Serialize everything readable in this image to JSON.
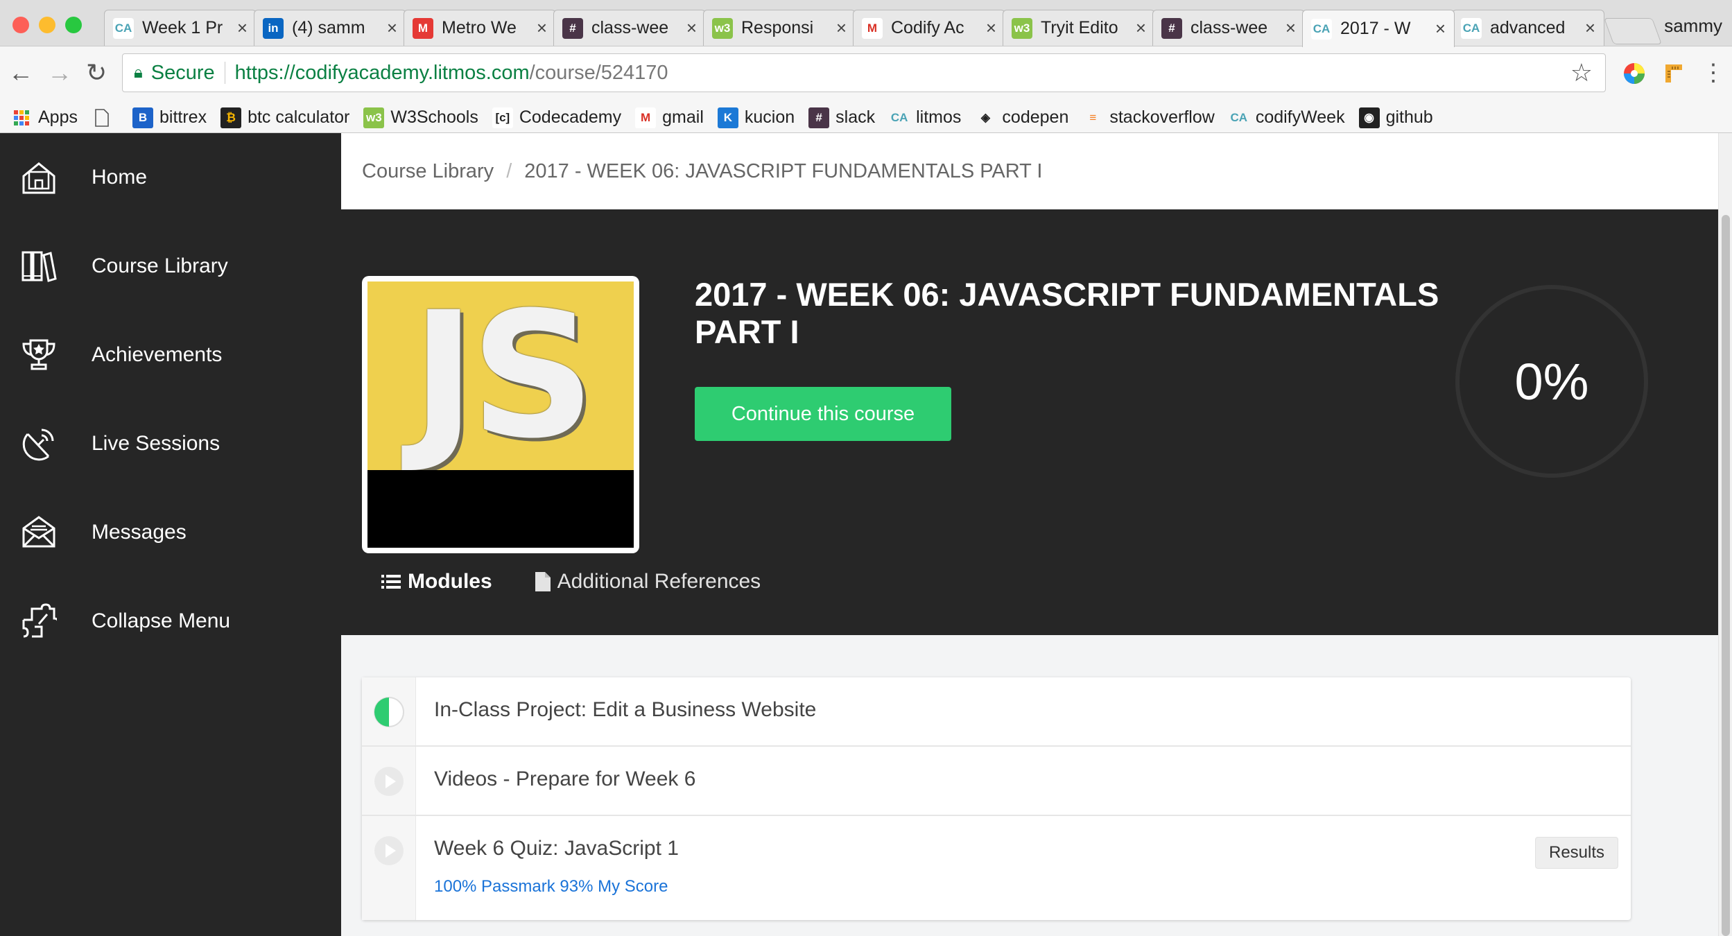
{
  "browser": {
    "tabs": [
      {
        "title": "Week 1 Pr",
        "favicon": "codify-icon",
        "color": "#ffffff",
        "text": "CA",
        "fg": "#4aa3b5"
      },
      {
        "title": "(4) samm",
        "favicon": "linkedin-icon",
        "color": "#0a66c2",
        "text": "in",
        "fg": "#ffffff"
      },
      {
        "title": "Metro We",
        "favicon": "metro-icon",
        "color": "#e53935",
        "text": "M",
        "fg": "#ffffff"
      },
      {
        "title": "class-wee",
        "favicon": "slack-icon",
        "color": "#4a3548",
        "text": "#",
        "fg": "#ffffff"
      },
      {
        "title": "Responsi",
        "favicon": "w3schools-icon",
        "color": "#8bc34a",
        "text": "w3",
        "fg": "#ffffff"
      },
      {
        "title": "Codify Ac",
        "favicon": "gmail-icon",
        "color": "#ffffff",
        "text": "M",
        "fg": "#d93025"
      },
      {
        "title": "Tryit Edito",
        "favicon": "w3schools-icon",
        "color": "#8bc34a",
        "text": "w3",
        "fg": "#ffffff"
      },
      {
        "title": "class-wee",
        "favicon": "slack-icon",
        "color": "#4a3548",
        "text": "#",
        "fg": "#ffffff"
      },
      {
        "title": "2017 - W",
        "favicon": "codify-icon",
        "color": "#ffffff",
        "text": "CA",
        "fg": "#4aa3b5"
      },
      {
        "title": "advanced",
        "favicon": "codify-icon",
        "color": "#ffffff",
        "text": "CA",
        "fg": "#4aa3b5"
      }
    ],
    "profile": "sammy",
    "url": {
      "secure_label": "Secure",
      "host": "https://codifyacademy.litmos.com",
      "path": "/course/524170"
    },
    "bookmarks": [
      {
        "label": "Apps",
        "icon": "apps-grid-icon",
        "color": "#ffffff",
        "text": "",
        "fg": "#444"
      },
      {
        "label": "",
        "icon": "page-icon",
        "color": "#ffffff",
        "text": "",
        "fg": "#444"
      },
      {
        "label": "bittrex",
        "icon": "bittrex-icon",
        "color": "#1d63c9",
        "text": "B",
        "fg": "#ffffff"
      },
      {
        "label": "btc calculator",
        "icon": "btc-icon",
        "color": "#222222",
        "text": "₿",
        "fg": "#f7b500"
      },
      {
        "label": "W3Schools",
        "icon": "w3schools-icon",
        "color": "#8bc34a",
        "text": "w3",
        "fg": "#ffffff"
      },
      {
        "label": "Codecademy",
        "icon": "codecademy-icon",
        "color": "#ffffff",
        "text": "[c]",
        "fg": "#222"
      },
      {
        "label": "gmail",
        "icon": "gmail-icon",
        "color": "#ffffff",
        "text": "M",
        "fg": "#d93025"
      },
      {
        "label": "kucion",
        "icon": "kucoin-icon",
        "color": "#1c79d6",
        "text": "K",
        "fg": "#ffffff"
      },
      {
        "label": "slack",
        "icon": "slack-icon",
        "color": "#4a3548",
        "text": "#",
        "fg": "#ffffff"
      },
      {
        "label": "litmos",
        "icon": "codify-icon",
        "color": "#f6f6f6",
        "text": "CA",
        "fg": "#4aa3b5"
      },
      {
        "label": "codepen",
        "icon": "codepen-icon",
        "color": "#f6f6f6",
        "text": "◈",
        "fg": "#222"
      },
      {
        "label": "stackoverflow",
        "icon": "stackoverflow-icon",
        "color": "#f6f6f6",
        "text": "≡",
        "fg": "#f48024"
      },
      {
        "label": "codifyWeek",
        "icon": "codify-icon",
        "color": "#f6f6f6",
        "text": "CA",
        "fg": "#4aa3b5"
      },
      {
        "label": "github",
        "icon": "github-icon",
        "color": "#222222",
        "text": "◉",
        "fg": "#ffffff"
      }
    ]
  },
  "sidebar": {
    "items": [
      {
        "label": "Home",
        "icon": "home-icon"
      },
      {
        "label": "Course Library",
        "icon": "library-icon"
      },
      {
        "label": "Achievements",
        "icon": "trophy-icon"
      },
      {
        "label": "Live Sessions",
        "icon": "broadcast-icon"
      },
      {
        "label": "Messages",
        "icon": "envelope-icon"
      },
      {
        "label": "Collapse Menu",
        "icon": "collapse-icon"
      }
    ]
  },
  "breadcrumb": {
    "root": "Course Library",
    "separator": "/",
    "current": "2017 - WEEK 06: JAVASCRIPT FUNDAMENTALS PART I"
  },
  "course": {
    "thumbnail_text": "JS",
    "title": "2017 - WEEK 06: JAVASCRIPT FUNDAMENTALS PART I",
    "continue_label": "Continue this course",
    "progress_label": "0%",
    "progress": 0,
    "tabs": {
      "modules": "Modules",
      "references": "Additional References"
    }
  },
  "modules": [
    {
      "title": "In-Class Project: Edit a Business Website",
      "status": "in-progress"
    },
    {
      "title": "Videos - Prepare for Week 6",
      "status": "not-started"
    },
    {
      "title": "Week 6 Quiz: JavaScript 1",
      "status": "not-started",
      "subtitle": "100% Passmark 93% My Score",
      "button": "Results"
    }
  ],
  "colors": {
    "sidebar": "#262626",
    "hero": "#262626",
    "accent_green": "#2ecc71",
    "link_blue": "#1a73d8",
    "js_yellow": "#efd04e"
  }
}
